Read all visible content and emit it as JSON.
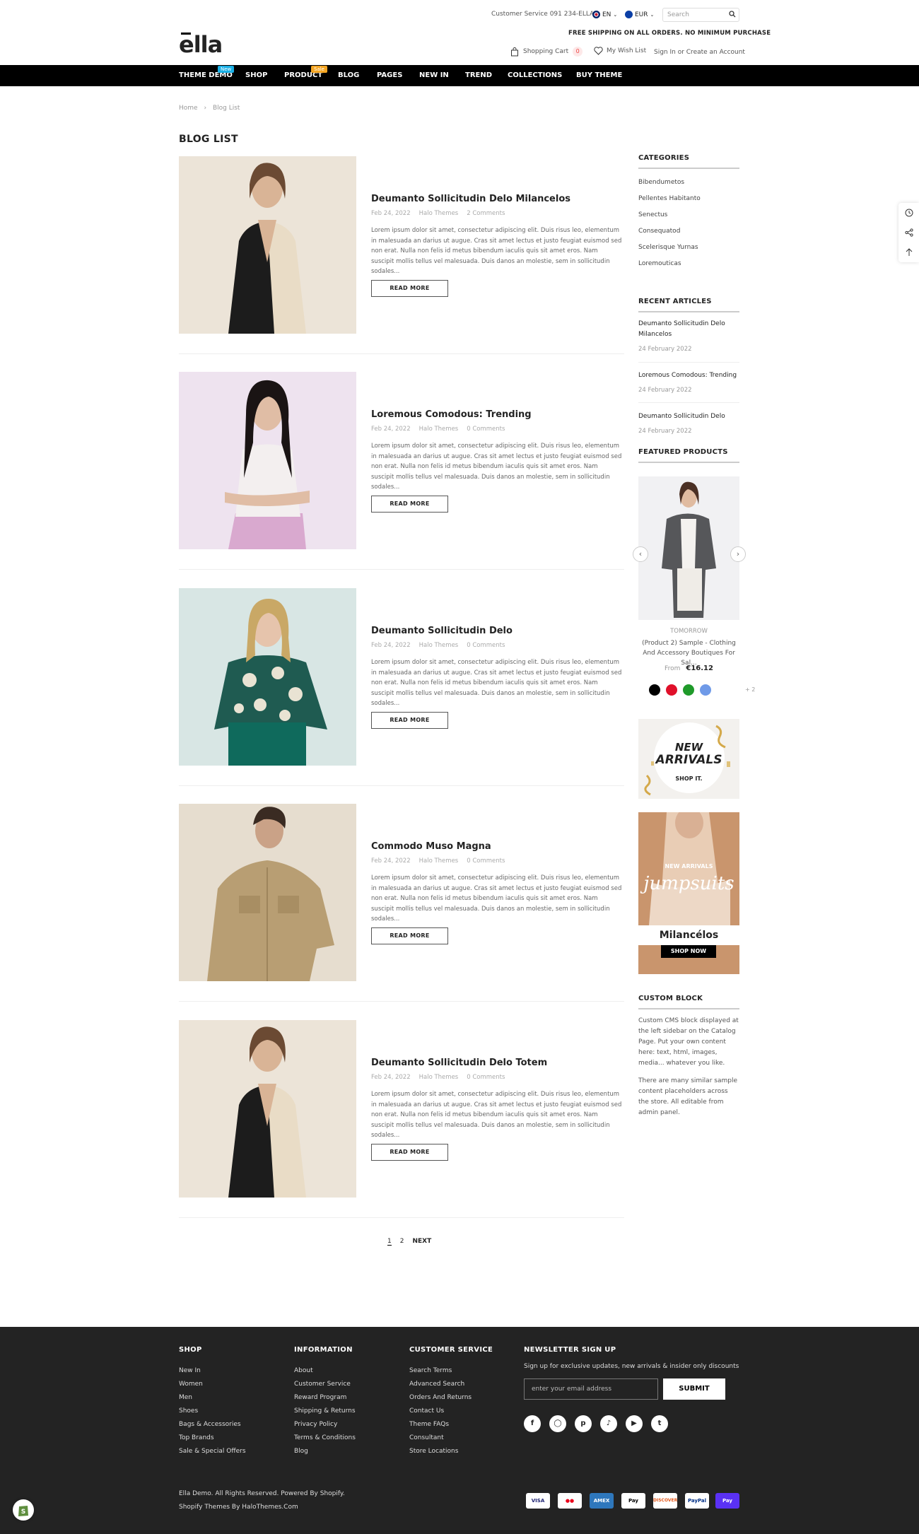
{
  "header": {
    "customer_service": "Customer Service 091 234-ELLA",
    "language": "EN",
    "currency": "EUR",
    "search_placeholder": "Search",
    "shipping_notice": "FREE SHIPPING ON ALL ORDERS. NO MINIMUM PURCHASE",
    "logo": "ella",
    "cart_label": "Shopping Cart",
    "cart_count": "0",
    "wishlist_label": "My Wish List",
    "account_label": "Sign In or Create an Account"
  },
  "nav": {
    "items": [
      "THEME DEMO",
      "SHOP",
      "PRODUCT",
      "BLOG",
      "PAGES",
      "NEW IN",
      "TREND",
      "COLLECTIONS",
      "BUY THEME"
    ],
    "badge_new": "New",
    "badge_sale": "Sale",
    "colors": {
      "new_badge": "#1ab0e6",
      "sale_badge": "#f5a623"
    }
  },
  "breadcrumb": {
    "home": "Home",
    "current": "Blog List"
  },
  "page_title": "BLOG LIST",
  "posts": [
    {
      "title": "Deumanto Sollicitudin Delo Milancelos",
      "date": "Feb 24, 2022",
      "author": "Halo Themes",
      "comments": "2 Comments",
      "excerpt": "Lorem ipsum dolor sit amet, consectetur adipiscing elit. Duis risus leo, elementum in malesuada an darius ut augue. Cras sit amet lectus et justo feugiat euismod sed non erat. Nulla non felis id metus bibendum iaculis quis sit amet eros. Nam suscipit mollis tellus vel malesuada. Duis danos an molestie, sem in sollicitudin sodales...",
      "button": "READ MORE"
    },
    {
      "title": "Loremous Comodous: Trending",
      "date": "Feb 24, 2022",
      "author": "Halo Themes",
      "comments": "0 Comments",
      "excerpt": "Lorem ipsum dolor sit amet, consectetur adipiscing elit. Duis risus leo, elementum in malesuada an darius ut augue. Cras sit amet lectus et justo feugiat euismod sed non erat. Nulla non felis id metus bibendum iaculis quis sit amet eros. Nam suscipit mollis tellus vel malesuada. Duis danos an molestie, sem in sollicitudin sodales...",
      "button": "READ MORE"
    },
    {
      "title": "Deumanto Sollicitudin Delo",
      "date": "Feb 24, 2022",
      "author": "Halo Themes",
      "comments": "0 Comments",
      "excerpt": "Lorem ipsum dolor sit amet, consectetur adipiscing elit. Duis risus leo, elementum in malesuada an darius ut augue. Cras sit amet lectus et justo feugiat euismod sed non erat. Nulla non felis id metus bibendum iaculis quis sit amet eros. Nam suscipit mollis tellus vel malesuada. Duis danos an molestie, sem in sollicitudin sodales...",
      "button": "READ MORE"
    },
    {
      "title": "Commodo Muso Magna",
      "date": "Feb 24, 2022",
      "author": "Halo Themes",
      "comments": "0 Comments",
      "excerpt": "Lorem ipsum dolor sit amet, consectetur adipiscing elit. Duis risus leo, elementum in malesuada an darius ut augue. Cras sit amet lectus et justo feugiat euismod sed non erat. Nulla non felis id metus bibendum iaculis quis sit amet eros. Nam suscipit mollis tellus vel malesuada. Duis danos an molestie, sem in sollicitudin sodales...",
      "button": "READ MORE"
    },
    {
      "title": "Deumanto Sollicitudin Delo Totem",
      "date": "Feb 24, 2022",
      "author": "Halo Themes",
      "comments": "0 Comments",
      "excerpt": "Lorem ipsum dolor sit amet, consectetur adipiscing elit. Duis risus leo, elementum in malesuada an darius ut augue. Cras sit amet lectus et justo feugiat euismod sed non erat. Nulla non felis id metus bibendum iaculis quis sit amet eros. Nam suscipit mollis tellus vel malesuada. Duis danos an molestie, sem in sollicitudin sodales...",
      "button": "READ MORE"
    }
  ],
  "pagination": {
    "page1": "1",
    "page2": "2",
    "next": "NEXT"
  },
  "sidebar": {
    "categories_title": "CATEGORIES",
    "categories": [
      "Bibendumetos",
      "Pellentes Habitanto",
      "Senectus",
      "Consequatod",
      "Scelerisque Yurnas",
      "Loremouticas"
    ],
    "recent_title": "RECENT ARTICLES",
    "recent": [
      {
        "title": "Deumanto Sollicitudin Delo Milancelos",
        "date": "24 February 2022"
      },
      {
        "title": "Loremous Comodous: Trending",
        "date": "24 February 2022"
      },
      {
        "title": "Deumanto Sollicitudin Delo",
        "date": "24 February 2022"
      }
    ],
    "featured_title": "FEATURED PRODUCTS",
    "product": {
      "vendor": "TOMORROW",
      "name": "(Product 2) Sample - Clothing And Accessory Boutiques For Sal...",
      "price_prefix": "From",
      "price": "€16.12",
      "swatches": [
        "#000000",
        "#e0102a",
        "#1f9a2a",
        "#6f9ae8"
      ],
      "more": "+ 2"
    },
    "banner1": {
      "line1": "NEW",
      "line2": "ARRIVALS",
      "cta": "SHOP IT."
    },
    "banner2": {
      "kicker": "NEW ARRIVALS",
      "script": "jumpsuits",
      "title": "Milancélos",
      "cta": "SHOP NOW"
    },
    "custom_title": "CUSTOM BLOCK",
    "custom_p1": "Custom CMS block displayed at the left sidebar on the Catalog Page. Put your own content here: text, html, images, media... whatever you like.",
    "custom_p2": "There are many similar sample content placeholders across the store. All editable from admin panel."
  },
  "footer": {
    "shop_title": "SHOP",
    "shop_links": [
      "New In",
      "Women",
      "Men",
      "Shoes",
      "Bags & Accessories",
      "Top Brands",
      "Sale & Special Offers"
    ],
    "info_title": "INFORMATION",
    "info_links": [
      "About",
      "Customer Service",
      "Reward Program",
      "Shipping & Returns",
      "Privacy Policy",
      "Terms & Conditions",
      "Blog"
    ],
    "cs_title": "CUSTOMER SERVICE",
    "cs_links": [
      "Search Terms",
      "Advanced Search",
      "Orders And Returns",
      "Contact Us",
      "Theme FAQs",
      "Consultant",
      "Store Locations"
    ],
    "newsletter_title": "NEWSLETTER SIGN UP",
    "newsletter_text": "Sign up for exclusive updates, new arrivals & insider only discounts",
    "email_placeholder": "enter your email address",
    "submit": "SUBMIT",
    "copyright": "Ella Demo. All Rights Reserved. Powered By Shopify.",
    "credits": "Shopify Themes By HaloThemes.Com",
    "payments": [
      "VISA",
      "MC",
      "AMEX",
      "Pay",
      "DISCOVER",
      "PayPal",
      "Pay"
    ],
    "social_icons": [
      "facebook-icon",
      "instagram-icon",
      "pinterest-icon",
      "tiktok-icon",
      "youtube-icon",
      "twitter-icon"
    ]
  }
}
